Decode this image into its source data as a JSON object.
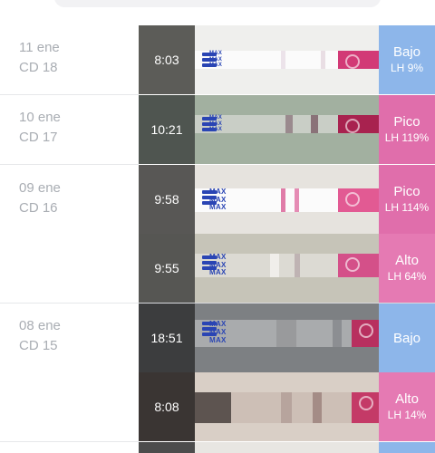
{
  "colors": {
    "bajo": "#8db6ea",
    "alto": "#e57ab3",
    "pico": "#e06eab"
  },
  "days": [
    {
      "date": "11 ene",
      "cd": "CD 18"
    },
    {
      "date": "10 ene",
      "cd": "CD 17"
    },
    {
      "date": "09 ene",
      "cd": "CD 16"
    },
    {
      "date": "08 ene",
      "cd": "CD 15"
    }
  ],
  "tests": [
    {
      "time": "8:03",
      "level": "Bajo",
      "lh": "LH 9%"
    },
    {
      "time": "10:21",
      "level": "Pico",
      "lh": "LH 119%"
    },
    {
      "time": "9:58",
      "level": "Pico",
      "lh": "LH 114%"
    },
    {
      "time": "9:55",
      "level": "Alto",
      "lh": "LH 64%"
    },
    {
      "time": "18:51",
      "level": "Bajo",
      "lh": ""
    },
    {
      "time": "8:08",
      "level": "Alto",
      "lh": "LH 14%"
    }
  ],
  "strip": {
    "brand_text": "MAX"
  }
}
